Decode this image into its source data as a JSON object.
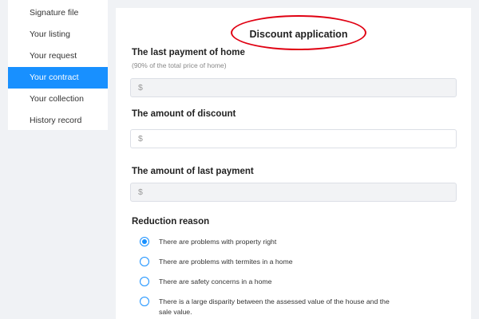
{
  "sidebar": {
    "items": [
      {
        "label": "Signature file"
      },
      {
        "label": "Your listing"
      },
      {
        "label": "Your request"
      },
      {
        "label": "Your contract",
        "active": true
      },
      {
        "label": "Your collection"
      },
      {
        "label": "History record"
      }
    ]
  },
  "page": {
    "title": "Discount application"
  },
  "form": {
    "last_payment": {
      "label": "The last payment of home",
      "hint": "(90% of the total price of home)",
      "placeholder": "$"
    },
    "discount_amount": {
      "label": "The amount of discount",
      "placeholder": "$"
    },
    "last_payment_amount": {
      "label": "The amount of last payment",
      "placeholder": "$"
    },
    "reduction_reason": {
      "label": "Reduction reason",
      "options": [
        {
          "label": "There are problems with property right",
          "checked": true
        },
        {
          "label": "There are problems with termites in a home",
          "checked": false
        },
        {
          "label": "There are safety concerns in a home",
          "checked": false
        },
        {
          "label": "There is a large disparity between the assessed value of the house and the sale value.",
          "checked": false
        }
      ]
    }
  },
  "colors": {
    "accent": "#1890ff",
    "annotation_circle": "#e00012"
  }
}
